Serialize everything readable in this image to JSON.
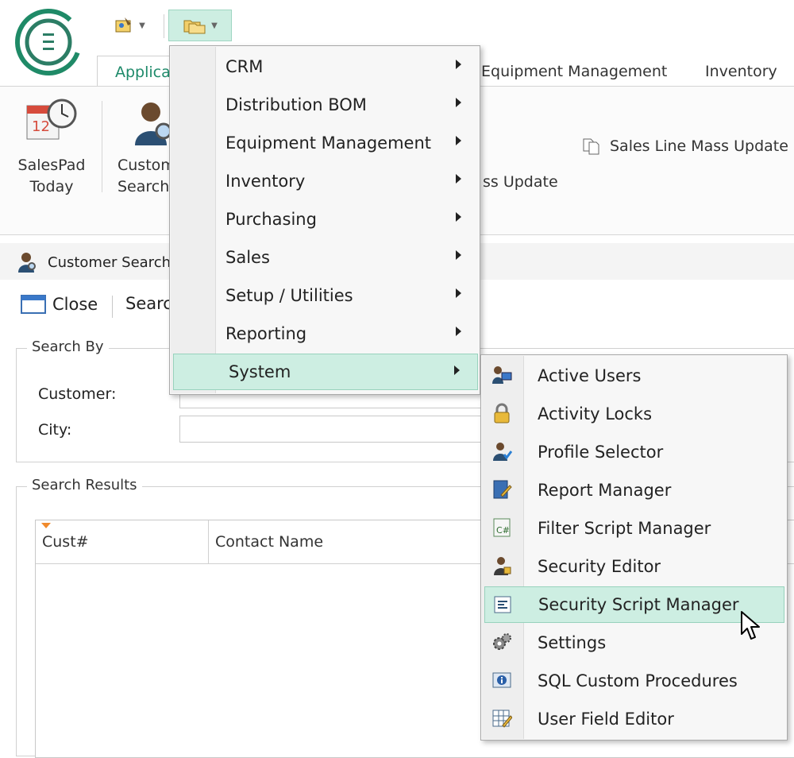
{
  "ribbon": {
    "tabs": {
      "applications": "Applications",
      "equipment_management": "Equipment Management",
      "inventory": "Inventory"
    },
    "buttons": {
      "salespad_today": "SalesPad\nToday",
      "customer_search": "Customer\nSearch",
      "mass_update_partial": "ss Update",
      "sales_line_mass_update": "Sales Line Mass Update"
    }
  },
  "document": {
    "tab_title": "Customer Search",
    "toolbar": {
      "close": "Close",
      "search": "Search"
    },
    "search_by": {
      "legend": "Search By",
      "customer_label": "Customer:",
      "city_label": "City:"
    },
    "results": {
      "legend": "Search Results",
      "columns": [
        "Cust#",
        "Contact Name"
      ]
    }
  },
  "menu": {
    "items": [
      "CRM",
      "Distribution BOM",
      "Equipment Management",
      "Inventory",
      "Purchasing",
      "Sales",
      "Setup / Utilities",
      "Reporting",
      "System"
    ],
    "active": "System"
  },
  "submenu": {
    "items": [
      {
        "label": "Active Users",
        "icon": "users-monitor-icon"
      },
      {
        "label": "Activity Locks",
        "icon": "lock-icon"
      },
      {
        "label": "Profile Selector",
        "icon": "profile-icon"
      },
      {
        "label": "Report Manager",
        "icon": "report-icon"
      },
      {
        "label": "Filter Script Manager",
        "icon": "csharp-script-icon"
      },
      {
        "label": "Security Editor",
        "icon": "security-user-icon"
      },
      {
        "label": "Security Script Manager",
        "icon": "script-icon"
      },
      {
        "label": "Settings",
        "icon": "gears-icon"
      },
      {
        "label": "SQL Custom Procedures",
        "icon": "info-panel-icon"
      },
      {
        "label": "User Field Editor",
        "icon": "grid-edit-icon"
      }
    ],
    "active": "Security Script Manager"
  },
  "colors": {
    "accent": "#1e8a6a",
    "highlight": "#cdeee2",
    "highlight_border": "#98d2bd"
  }
}
